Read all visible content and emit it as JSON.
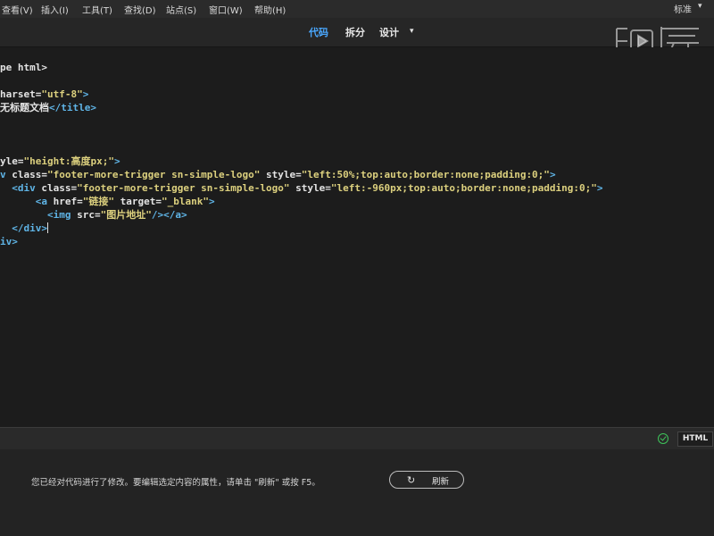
{
  "menubar": {
    "items": [
      "查看(V)",
      "插入(I)",
      "工具(T)",
      "查找(D)",
      "站点(S)",
      "窗口(W)",
      "帮助(H)"
    ],
    "workspace": "标准",
    "workspace_caret": "▾"
  },
  "viewbar": {
    "tabs": [
      "代码",
      "拆分",
      "设计"
    ],
    "active": "代码",
    "design_caret": "▾"
  },
  "watermark": {
    "text": "虎课"
  },
  "editor": {
    "lines": [
      [
        {
          "t": "pe html>",
          "c": "c-white"
        }
      ],
      [],
      [
        {
          "t": "harset=",
          "c": "c-white"
        },
        {
          "t": "\"utf-8\"",
          "c": "c-str"
        },
        {
          "t": ">",
          "c": "c-blue"
        }
      ],
      [
        {
          "t": "无标题文档",
          "c": "c-white"
        },
        {
          "t": "</title>",
          "c": "c-blue"
        }
      ],
      [],
      [],
      [],
      [
        {
          "t": "yle=",
          "c": "c-white"
        },
        {
          "t": "\"height:高度px;\"",
          "c": "c-str"
        },
        {
          "t": ">",
          "c": "c-blue"
        }
      ],
      [
        {
          "t": "v ",
          "c": "c-blue"
        },
        {
          "t": "class=",
          "c": "c-white"
        },
        {
          "t": "\"footer-more-trigger sn-simple-logo\"",
          "c": "c-str"
        },
        {
          "t": " style=",
          "c": "c-white"
        },
        {
          "t": "\"left:50%;top:auto;border:none;padding:0;\"",
          "c": "c-str"
        },
        {
          "t": ">",
          "c": "c-blue"
        }
      ],
      [
        {
          "t": "  <div ",
          "c": "c-blue"
        },
        {
          "t": "class=",
          "c": "c-white"
        },
        {
          "t": "\"footer-more-trigger sn-simple-logo\"",
          "c": "c-str"
        },
        {
          "t": " style=",
          "c": "c-white"
        },
        {
          "t": "\"left:-960px;top:auto;border:none;padding:0;\"",
          "c": "c-str"
        },
        {
          "t": ">",
          "c": "c-blue"
        }
      ],
      [
        {
          "t": "      <a ",
          "c": "c-blue"
        },
        {
          "t": "href=",
          "c": "c-white"
        },
        {
          "t": "\"链接\"",
          "c": "c-str"
        },
        {
          "t": " target=",
          "c": "c-white"
        },
        {
          "t": "\"_blank\"",
          "c": "c-str"
        },
        {
          "t": ">",
          "c": "c-blue"
        }
      ],
      [
        {
          "t": "        <img ",
          "c": "c-blue"
        },
        {
          "t": "src=",
          "c": "c-white"
        },
        {
          "t": "\"图片地址\"",
          "c": "c-str"
        },
        {
          "t": "/></a>",
          "c": "c-blue"
        }
      ],
      [
        {
          "t": "  </div>",
          "c": "c-blue"
        }
      ],
      [
        {
          "t": "iv>",
          "c": "c-blue"
        }
      ]
    ]
  },
  "statusbar": {
    "language": "HTML"
  },
  "notice": {
    "message": "您已经对代码进行了修改。要编辑选定内容的属性，请单击 \"刷新\" 或按 F5。",
    "refresh_icon": "↻",
    "refresh_label": "刷新"
  },
  "colors": {
    "accent": "#4aa8ff",
    "ok": "#3ec45a",
    "string": "#dcd07e",
    "tag": "#5fb4e6"
  }
}
